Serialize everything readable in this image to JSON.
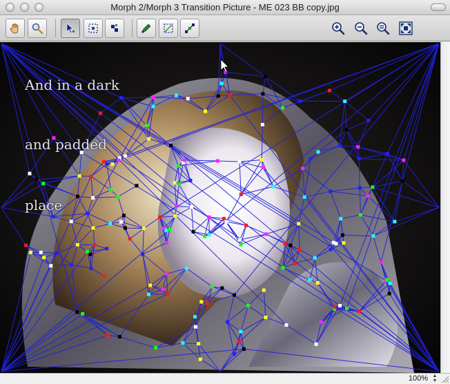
{
  "window": {
    "title": "Morph 2/Morph 3 Transition Picture - ME 023 BB copy.jpg"
  },
  "toolbar": {
    "tools": [
      {
        "name": "hand-tool-button",
        "icon": "hand-icon",
        "active": false
      },
      {
        "name": "magnifier-tool-button",
        "icon": "magnifier-icon",
        "active": false
      },
      {
        "name": "point-select-tool-button",
        "icon": "arrow-select-icon",
        "active": true
      },
      {
        "name": "marquee-select-tool-button",
        "icon": "marquee-icon",
        "active": false
      },
      {
        "name": "add-point-tool-button",
        "icon": "add-point-icon",
        "active": false
      },
      {
        "name": "pen-tool-button",
        "icon": "pen-icon",
        "active": false
      },
      {
        "name": "dashed-select-tool-button",
        "icon": "dashed-rect-icon",
        "active": false
      },
      {
        "name": "line-tool-button",
        "icon": "line-tool-icon",
        "active": false
      }
    ],
    "zoom_buttons": [
      {
        "name": "zoom-in-button",
        "icon": "zoom-in-icon"
      },
      {
        "name": "zoom-out-button",
        "icon": "zoom-out-icon"
      },
      {
        "name": "zoom-reset-button",
        "icon": "zoom-actual-icon"
      },
      {
        "name": "zoom-fit-button",
        "icon": "fit-to-window-icon"
      }
    ]
  },
  "canvas": {
    "overlay_lines": [
      "And in a dark",
      "and padded",
      "place"
    ],
    "mesh_color": "#2222dd",
    "point_colors": [
      "#ffffff",
      "#ff1a1a",
      "#1aff1a",
      "#ff22ff",
      "#ffff22",
      "#22ffff",
      "#2222ff",
      "#000000"
    ]
  },
  "status": {
    "zoom": "100%"
  },
  "colors": {
    "accent": "#2222dd"
  }
}
